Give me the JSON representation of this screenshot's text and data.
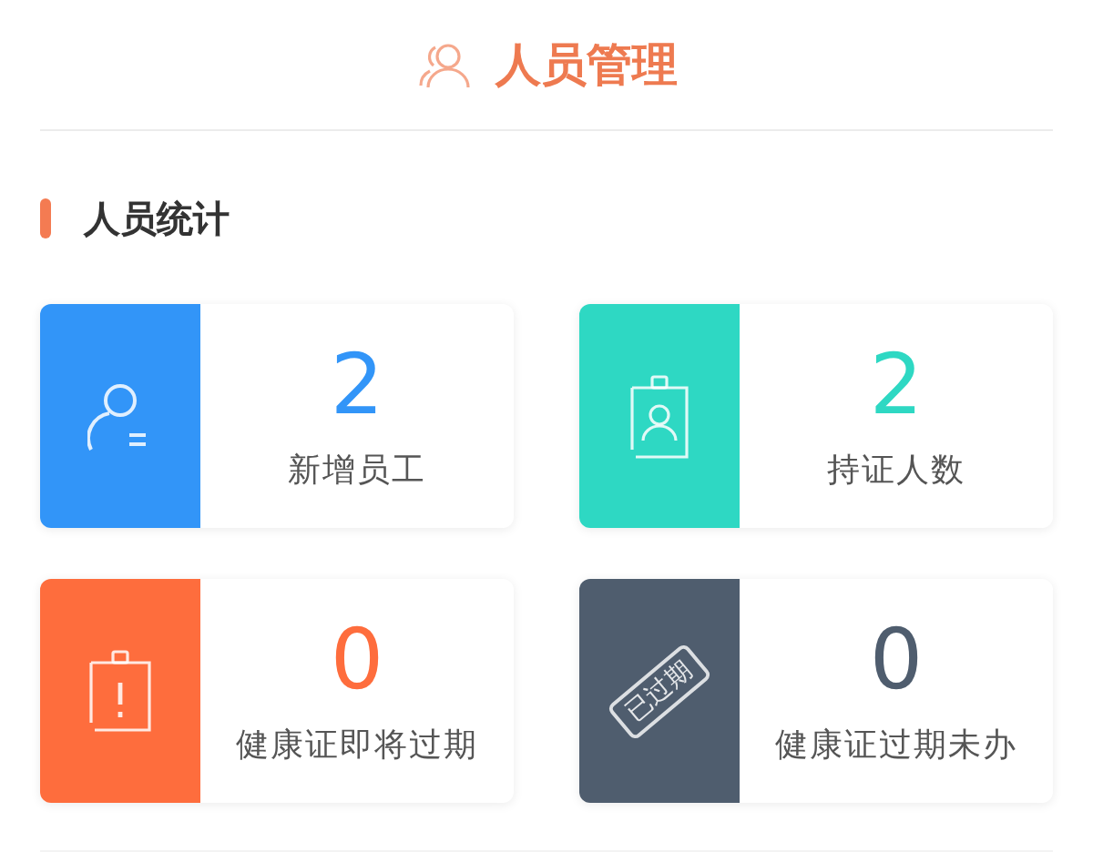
{
  "header": {
    "title": "人员管理"
  },
  "section": {
    "title": "人员统计"
  },
  "stats": [
    {
      "kind": "new-staff",
      "value": "2",
      "label": "新增员工",
      "color": "#3295f8"
    },
    {
      "kind": "badge",
      "value": "2",
      "label": "持证人数",
      "color": "#2ed8c3"
    },
    {
      "kind": "warning",
      "value": "0",
      "label": "健康证即将过期",
      "color": "#fe6d3d"
    },
    {
      "kind": "stamp",
      "value": "0",
      "label": "健康证过期未办",
      "color": "#4f5d6e",
      "stamp_text": "已过期"
    }
  ]
}
